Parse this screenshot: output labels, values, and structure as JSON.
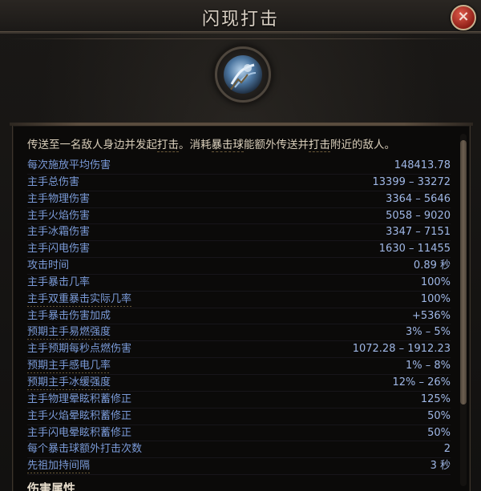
{
  "window": {
    "title": "闪现打击",
    "close_label": "×"
  },
  "skill": {
    "icon": "flicker-strike-icon",
    "description_parts": [
      {
        "text": "传送至一名敌人身边并发起",
        "kw": false
      },
      {
        "text": "打击",
        "kw": true
      },
      {
        "text": "。消耗",
        "kw": false
      },
      {
        "text": "暴击球",
        "kw": true
      },
      {
        "text": "能额外传送并",
        "kw": false
      },
      {
        "text": "打击",
        "kw": true
      },
      {
        "text": "附近的敌人。",
        "kw": false
      }
    ]
  },
  "stats": [
    {
      "label": "每次施放平均伤害",
      "value": "148413.78",
      "dotted": false
    },
    {
      "label": "主手总伤害",
      "value": "13399 – 33272",
      "dotted": false
    },
    {
      "label": "主手物理伤害",
      "value": "3364 – 5646",
      "dotted": false
    },
    {
      "label": "主手火焰伤害",
      "value": "5058 – 9020",
      "dotted": false
    },
    {
      "label": "主手冰霜伤害",
      "value": "3347 – 7151",
      "dotted": false
    },
    {
      "label": "主手闪电伤害",
      "value": "1630 – 11455",
      "dotted": false
    },
    {
      "label": "攻击时间",
      "value": "0.89 秒",
      "dotted": false
    },
    {
      "label": "主手暴击几率",
      "value": "100%",
      "dotted": false
    },
    {
      "label": "主手双重暴击实际几率",
      "value": "100%",
      "dotted": true
    },
    {
      "label": "主手暴击伤害加成",
      "value": "+536%",
      "dotted": false
    },
    {
      "label": "预期主手易燃强度",
      "value": "3% – 5%",
      "dotted": true
    },
    {
      "label": "主手预期每秒点燃伤害",
      "value": "1072.28 – 1912.23",
      "dotted": false
    },
    {
      "label": "预期主手感电几率",
      "value": "1% – 8%",
      "dotted": true
    },
    {
      "label": "预期主手冰缓强度",
      "value": "12% – 26%",
      "dotted": true
    },
    {
      "label": "主手物理晕眩积蓄修正",
      "value": "125%",
      "dotted": false
    },
    {
      "label": "主手火焰晕眩积蓄修正",
      "value": "50%",
      "dotted": false
    },
    {
      "label": "主手闪电晕眩积蓄修正",
      "value": "50%",
      "dotted": false
    },
    {
      "label": "每个暴击球额外打击次数",
      "value": "2",
      "dotted": false
    },
    {
      "label": "先祖加持间隔",
      "value": "3 秒",
      "dotted": true
    }
  ],
  "section": {
    "title": "伤害属性"
  },
  "colors": {
    "stat_label": "#7a9ad8",
    "stat_value": "#9fb7e6",
    "description": "#d7ccb8",
    "close_button": "#c0392b"
  }
}
